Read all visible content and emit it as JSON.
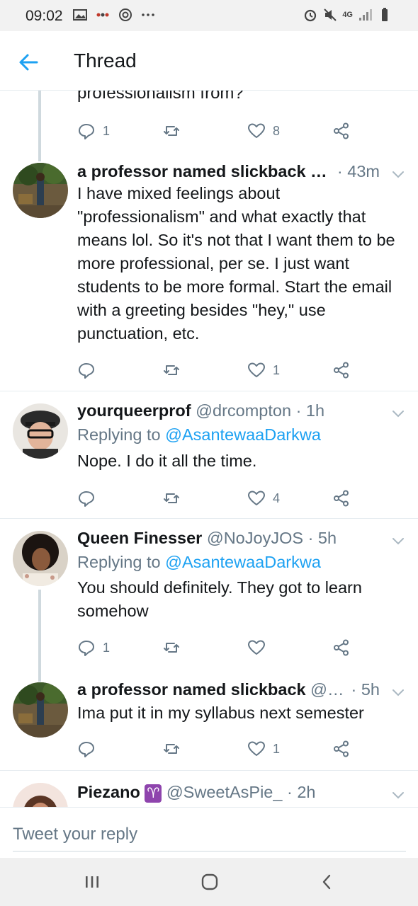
{
  "status_bar": {
    "time": "09:02",
    "network": "4G"
  },
  "header": {
    "title": "Thread"
  },
  "partial_top": {
    "text": "professionalism from?",
    "actions": {
      "reply_count": "1",
      "retweet_count": "",
      "like_count": "8"
    }
  },
  "tweets": [
    {
      "name": "a professor named slickback …",
      "handle": "",
      "time": "· 43m",
      "replying_to": "",
      "body": "I have mixed feelings about \"professionalism\" and what exactly that means lol. So it's not that I want them to be more professional, per se. I just want students to be more formal. Start the email with a greeting besides \"hey,\" use punctuation, etc.",
      "actions": {
        "reply_count": "",
        "retweet_count": "",
        "like_count": "1"
      }
    },
    {
      "name": "yourqueerprof",
      "handle": "@drcompton",
      "time": "· 1h",
      "replying_to_prefix": "Replying to ",
      "replying_to": "@AsantewaaDarkwa",
      "body": "Nope. I do it all the time.",
      "actions": {
        "reply_count": "",
        "retweet_count": "",
        "like_count": "4"
      }
    },
    {
      "name": "Queen Finesser",
      "handle": "@NoJoyJOS",
      "time": "· 5h",
      "replying_to_prefix": "Replying to ",
      "replying_to": "@AsantewaaDarkwa",
      "body": "You should definitely. They got to learn somehow",
      "actions": {
        "reply_count": "1",
        "retweet_count": "",
        "like_count": ""
      }
    },
    {
      "name": "a professor named slickback",
      "handle": "@…",
      "time": "· 5h",
      "replying_to": "",
      "body": "Ima put it in my syllabus next semester",
      "actions": {
        "reply_count": "",
        "retweet_count": "",
        "like_count": "1"
      }
    },
    {
      "name": "Piezano",
      "badge": "♈",
      "handle": "@SweetAsPie_",
      "time": "· 2h"
    }
  ],
  "compose": {
    "placeholder": "Tweet your reply"
  },
  "colors": {
    "accent": "#1da1f2",
    "secondary_text": "#657786",
    "thread_line": "#cfd9de",
    "badge_purple": "#8e44ad"
  },
  "icons": [
    "back-arrow-icon",
    "reply-icon",
    "retweet-icon",
    "like-icon",
    "share-icon",
    "chevron-down-icon",
    "recents-icon",
    "home-icon",
    "back-icon"
  ]
}
